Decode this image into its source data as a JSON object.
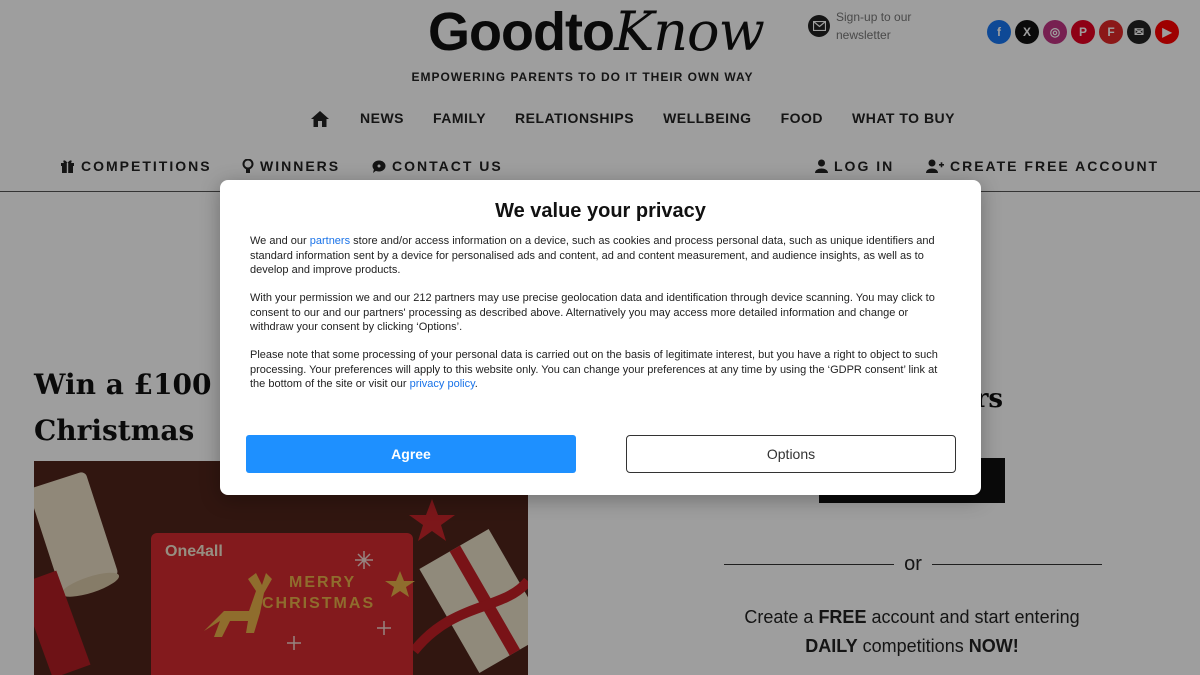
{
  "header": {
    "logo_part1": "Goodto",
    "logo_part2": "Know",
    "newsletter_text": "Sign-up to our newsletter",
    "tagline": "EMPOWERING PARENTS TO DO IT THEIR OWN WAY",
    "socials": [
      {
        "name": "facebook-icon",
        "color": "#1877f2",
        "glyph": "f"
      },
      {
        "name": "x-icon",
        "color": "#111111",
        "glyph": "X"
      },
      {
        "name": "instagram-icon",
        "color": "#c13584",
        "glyph": "◎"
      },
      {
        "name": "pinterest-icon",
        "color": "#e60023",
        "glyph": "P"
      },
      {
        "name": "flipboard-icon",
        "color": "#e12828",
        "glyph": "F"
      },
      {
        "name": "email-icon",
        "color": "#222222",
        "glyph": "✉"
      },
      {
        "name": "youtube-icon",
        "color": "#ff0000",
        "glyph": "▶"
      }
    ]
  },
  "main_nav": {
    "items": [
      "NEWS",
      "FAMILY",
      "RELATIONSHIPS",
      "WELLBEING",
      "FOOD",
      "WHAT TO BUY"
    ]
  },
  "sub_nav": {
    "competitions": "COMPETITIONS",
    "winners": "WINNERS",
    "contact_us": "CONTACT US",
    "log_in": "LOG IN",
    "create_account": "CREATE FREE ACCOUNT"
  },
  "article": {
    "title_visible": "Win a £100 O Christmas"
  },
  "sidebar": {
    "title_fragment": "bers",
    "or_text": "or",
    "promo_line1_a": "Create a ",
    "promo_line1_b": "FREE",
    "promo_line1_c": " account and start entering",
    "promo_line2_a": "DAILY",
    "promo_line2_b": " competitions ",
    "promo_line2_c": "NOW!"
  },
  "hero_card": {
    "brand": "One4all",
    "line1": "MERRY",
    "line2": "CHRISTMAS"
  },
  "consent": {
    "title": "We value your privacy",
    "p1_before": "We and our ",
    "p1_link": "partners",
    "p1_after": " store and/or access information on a device, such as cookies and process personal data, such as unique identifiers and standard information sent by a device for personalised ads and content, ad and content measurement, and audience insights, as well as to develop and improve products.",
    "p2": "With your permission we and our 212 partners may use precise geolocation data and identification through device scanning. You may click to consent to our and our partners' processing as described above. Alternatively you may access more detailed information and change or withdraw your consent by clicking ‘Options’.",
    "p3_before": "Please note that some processing of your personal data is carried out on the basis of legitimate interest, but you have a right to object to such processing. Your preferences will apply to this website only. You can change your preferences at any time by using the ‘GDPR consent’ link at the bottom of the site or visit our ",
    "p3_link": "privacy policy",
    "p3_after": ".",
    "agree_label": "Agree",
    "options_label": "Options",
    "agree_color": "#1e90ff"
  }
}
